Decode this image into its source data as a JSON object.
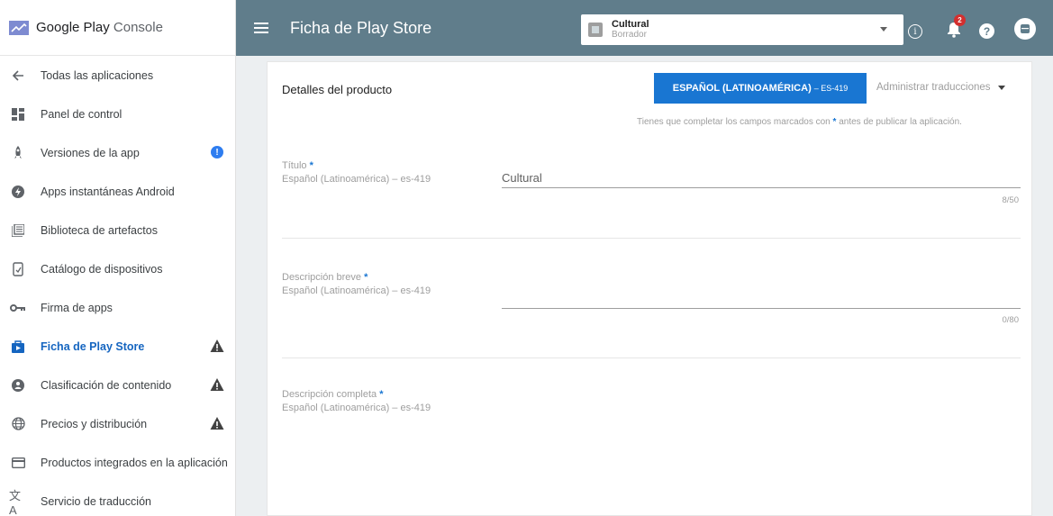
{
  "brand": {
    "name_part1": "Google Play",
    "name_part2": "Console"
  },
  "sidebar": {
    "items": [
      {
        "label": "Todas las aplicaciones",
        "icon": "arrow-left-icon"
      },
      {
        "label": "Panel de control",
        "icon": "dashboard-icon"
      },
      {
        "label": "Versiones de la app",
        "icon": "rocket-icon",
        "badge": "!"
      },
      {
        "label": "Apps instantáneas Android",
        "icon": "instant-app-icon"
      },
      {
        "label": "Biblioteca de artefactos",
        "icon": "library-icon"
      },
      {
        "label": "Catálogo de dispositivos",
        "icon": "device-icon"
      },
      {
        "label": "Firma de apps",
        "icon": "key-icon"
      },
      {
        "label": "Ficha de Play Store",
        "icon": "store-icon",
        "active": true,
        "warning": true
      },
      {
        "label": "Clasificación de contenido",
        "icon": "rating-icon",
        "warning": true
      },
      {
        "label": "Precios y distribución",
        "icon": "globe-icon",
        "warning": true
      },
      {
        "label": "Productos integrados en la aplicación",
        "icon": "card-icon"
      },
      {
        "label": "Servicio de traducción",
        "icon": "translate-icon"
      }
    ]
  },
  "header": {
    "title": "Ficha de Play Store",
    "app_selector": {
      "name": "Cultural",
      "status": "Borrador"
    },
    "notification_count": "2"
  },
  "main": {
    "section_title": "Detalles del producto",
    "language_button": {
      "label": "ESPAÑOL (LATINOAMÉRICA)",
      "code": "– ES-419"
    },
    "manage_translations": "Administrar traducciones",
    "notice_before": "Tienes que completar los campos marcados con",
    "notice_star": "*",
    "notice_after": "antes de publicar la aplicación.",
    "fields": {
      "title": {
        "label": "Título",
        "star": "*",
        "locale": "Español (Latinoamérica) – es-419",
        "value": "Cultural",
        "counter": "8/50"
      },
      "short_desc": {
        "label": "Descripción breve",
        "star": "*",
        "locale": "Español (Latinoamérica) – es-419",
        "value": "",
        "counter": "0/80"
      },
      "full_desc": {
        "label": "Descripción completa",
        "star": "*",
        "locale": "Español (Latinoamérica) – es-419"
      }
    }
  },
  "colors": {
    "topbar": "#607d8b",
    "accent": "#1976d2",
    "active": "#1565c0",
    "warning": "#424242"
  }
}
